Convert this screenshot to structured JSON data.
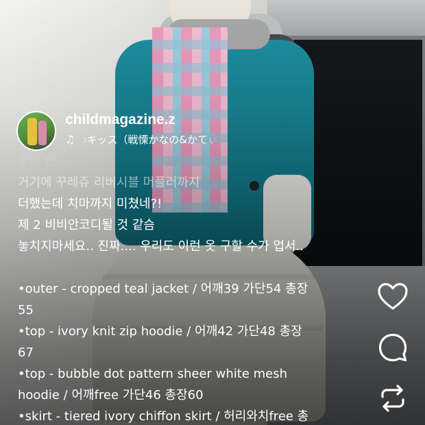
{
  "post": {
    "username": "childmagazine.z",
    "music": {
      "title": "ͻキッス（戦慄かなの&かてぃ"
    },
    "caption_lines": [
      "우리 반 ...",
      "거기에 꾸레쥬 리버시블 머플러까지",
      "더했는데 치마까지 미쳤네?!",
      "제 2 비비안코디될 것 같슴",
      "놓치지마세요.. 진짜.... 우리도 이런 옷 구할 수가 업서..",
      "",
      "•outer - cropped teal jacket / 어깨39 가단54 총장",
      "55",
      "•top - ivory knit zip hoodie / 어깨42 가단48 총장",
      "67",
      "•top - bubble dot pattern sheer white mesh",
      "hoodie / 어깨free 가단46 총장60",
      "•skirt - tiered ivory chiffon skirt / 허리와치free 총"
    ]
  },
  "actions": {
    "like": "heart-icon",
    "comment": "comment-icon",
    "repost": "repost-icon"
  }
}
